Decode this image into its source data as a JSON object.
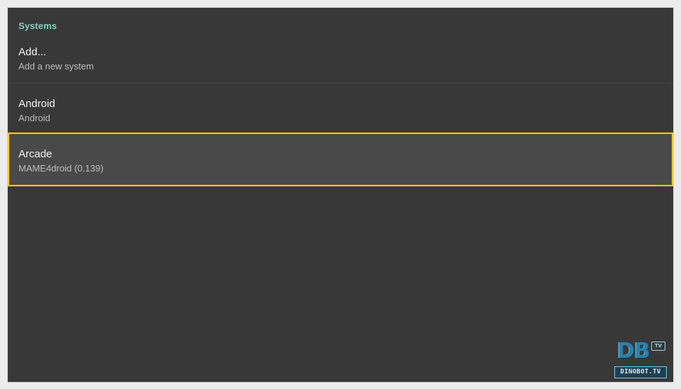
{
  "section": {
    "title": "Systems"
  },
  "items": [
    {
      "title": "Add...",
      "subtitle": "Add a new system",
      "selected": false
    },
    {
      "title": "Android",
      "subtitle": "Android",
      "selected": false
    },
    {
      "title": "Arcade",
      "subtitle": "MAME4droid (0.139)",
      "selected": true
    }
  ],
  "watermark": {
    "letters": "DB",
    "badge": "TV",
    "text": "DINOBOT.TV"
  },
  "colors": {
    "background": "#383838",
    "header_accent": "#7fd0c0",
    "selection_border": "#f2c928",
    "selection_fill": "#494949"
  }
}
